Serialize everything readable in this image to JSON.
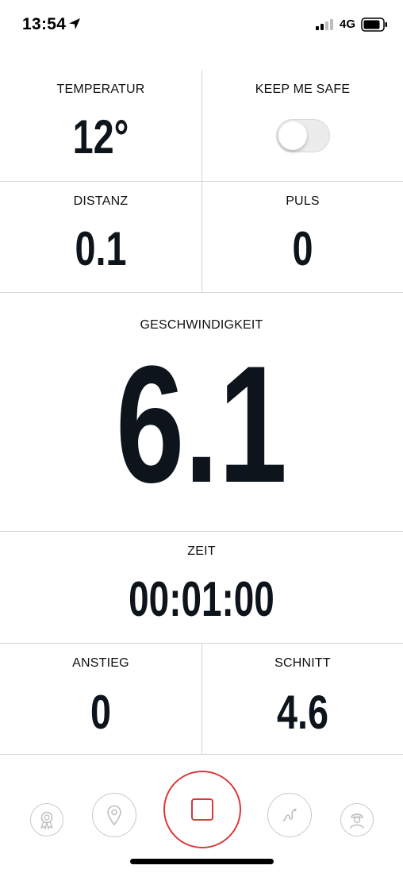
{
  "status_bar": {
    "time": "13:54",
    "network": "4G",
    "icons": [
      "location-arrow-icon",
      "signal-icon",
      "battery-icon"
    ]
  },
  "metrics": {
    "temperature": {
      "label": "TEMPERATUR",
      "value": "12°"
    },
    "keep_me_safe": {
      "label": "KEEP ME SAFE",
      "toggle_on": false
    },
    "distance": {
      "label": "DISTANZ",
      "value": "0.1"
    },
    "pulse": {
      "label": "PULS",
      "value": "0"
    },
    "speed": {
      "label": "GESCHWINDIGKEIT",
      "value": "6.1"
    },
    "time": {
      "label": "ZEIT",
      "value": "00:01:00"
    },
    "climb": {
      "label": "ANSTIEG",
      "value": "0"
    },
    "average": {
      "label": "SCHNITT",
      "value": "4.6"
    }
  },
  "bottom_nav": {
    "items": [
      "award-icon",
      "map-pin-icon",
      "stop-record-icon",
      "route-icon",
      "rider-helmet-icon"
    ],
    "accent_color": "#d9393b"
  }
}
